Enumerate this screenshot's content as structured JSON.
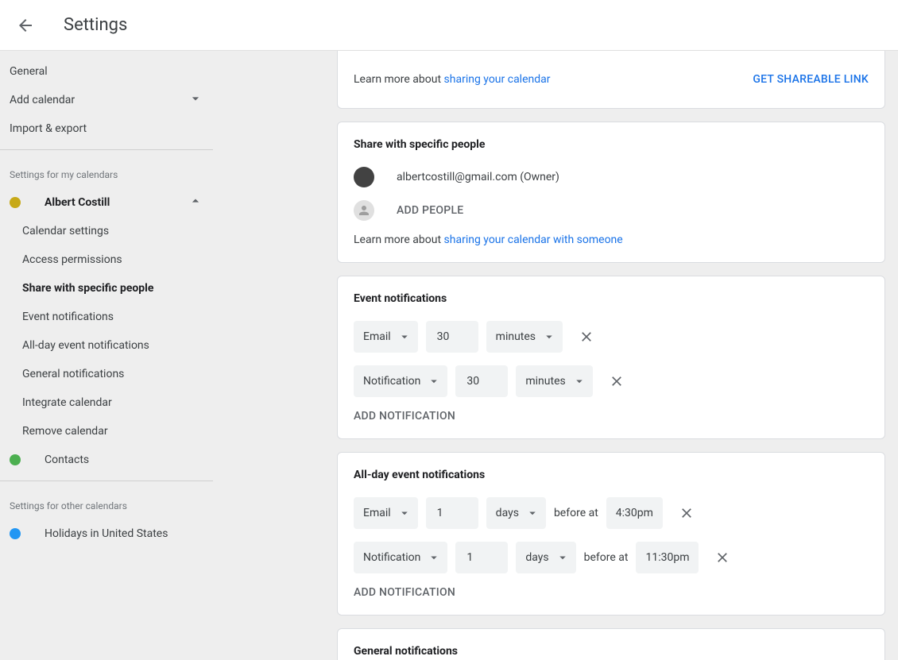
{
  "header": {
    "title": "Settings"
  },
  "sidebar": {
    "general": "General",
    "add_calendar": "Add calendar",
    "import_export": "Import & export",
    "my_cal_heading": "Settings for my calendars",
    "calendar1": {
      "name": "Albert Costill",
      "color": "#c7a918",
      "items": {
        "settings": "Calendar settings",
        "access": "Access permissions",
        "share": "Share with specific people",
        "event_notif": "Event notifications",
        "allday": "All-day event notifications",
        "general_notif": "General notifications",
        "integrate": "Integrate calendar",
        "remove": "Remove calendar"
      }
    },
    "contacts": {
      "name": "Contacts",
      "color": "#4caf50"
    },
    "other_heading": "Settings for other calendars",
    "holidays": {
      "name": "Holidays in United States",
      "color": "#2196f3"
    }
  },
  "main": {
    "learn_sharing_prefix": "Learn more about ",
    "learn_sharing_link": "sharing your calendar",
    "get_link": "GET SHAREABLE LINK",
    "share_section": {
      "title": "Share with specific people",
      "owner_email": "albertcostill@gmail.com (Owner)",
      "add_people": "ADD PEOPLE",
      "learn_prefix": "Learn more about ",
      "learn_link": "sharing your calendar with someone"
    },
    "event_notif_section": {
      "title": "Event notifications",
      "rows": [
        {
          "type": "Email",
          "value": "30",
          "unit": "minutes"
        },
        {
          "type": "Notification",
          "value": "30",
          "unit": "minutes"
        }
      ],
      "add": "ADD NOTIFICATION"
    },
    "allday_section": {
      "title": "All-day event notifications",
      "before_at": "before at",
      "rows": [
        {
          "type": "Email",
          "value": "1",
          "unit": "days",
          "time": "4:30pm"
        },
        {
          "type": "Notification",
          "value": "1",
          "unit": "days",
          "time": "11:30pm"
        }
      ],
      "add": "ADD NOTIFICATION"
    },
    "general_notif_section": {
      "title": "General notifications"
    }
  }
}
